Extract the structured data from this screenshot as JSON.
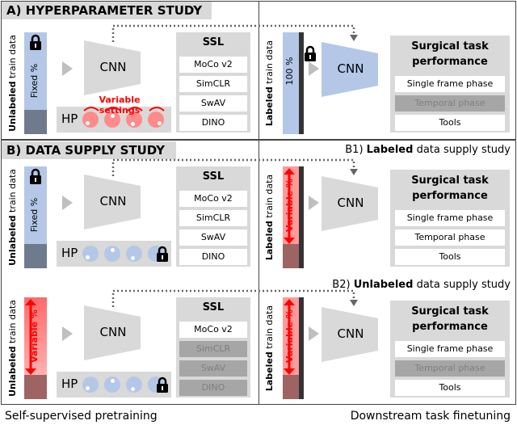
{
  "colors": {
    "blue": "#b4c7e7",
    "dark": "#6f7a8c",
    "red": "#ff3b3b",
    "pink": "#ff9a9a",
    "darkred": "#9e6464",
    "gray": "#d9d9d9"
  },
  "titles": {
    "a": "A) HYPERPARAMETER STUDY",
    "b": "B) DATA SUPPLY STUDY"
  },
  "sub": {
    "b1_prefix": "B1) ",
    "b1_bold": "Labeled",
    "b1_rest": " data supply study",
    "b2_prefix": "B2) ",
    "b2_bold": "Unlabeled",
    "b2_rest": " data supply study"
  },
  "footer": {
    "left": "Self-supervised pretraining",
    "right": "Downstream task finetuning"
  },
  "common": {
    "unlabeled_bold": "Unlabeled",
    "labeled_bold": "Labeled",
    "train_data": " train data",
    "cnn": "CNN",
    "hp": "HP",
    "ssl": "SSL",
    "surgical_1": "Surgical task",
    "surgical_2": "performance",
    "variable_settings": "Variable settings",
    "icons": [
      "lock-icon",
      "arrow-right-icon",
      "double-arrow-icon"
    ]
  },
  "panels": [
    {
      "left_bar": "Fixed %",
      "left_mode": "fixed",
      "hp_mode": "variable",
      "ssl": [
        {
          "label": "MoCo v2",
          "on": true
        },
        {
          "label": "SimCLR",
          "on": true
        },
        {
          "label": "SwAV",
          "on": true
        },
        {
          "label": "DINO",
          "on": true
        }
      ],
      "right_bar": "100 %",
      "right_mode": "full",
      "tasks": [
        {
          "label": "Single frame phase",
          "on": true
        },
        {
          "label": "Temporal phase",
          "on": false
        },
        {
          "label": "Tools",
          "on": true
        }
      ]
    },
    {
      "left_bar": "Fixed %",
      "left_mode": "fixed",
      "hp_mode": "locked",
      "ssl": [
        {
          "label": "MoCo v2",
          "on": true
        },
        {
          "label": "SimCLR",
          "on": true
        },
        {
          "label": "SwAV",
          "on": true
        },
        {
          "label": "DINO",
          "on": true
        }
      ],
      "right_bar": "Variable %",
      "right_mode": "variable",
      "tasks": [
        {
          "label": "Single frame phase",
          "on": true
        },
        {
          "label": "Temporal phase",
          "on": true
        },
        {
          "label": "Tools",
          "on": true
        }
      ]
    },
    {
      "left_bar": "Variable %",
      "left_mode": "variable",
      "hp_mode": "locked",
      "ssl": [
        {
          "label": "MoCo v2",
          "on": true
        },
        {
          "label": "SimCLR",
          "on": false
        },
        {
          "label": "SwAV",
          "on": false
        },
        {
          "label": "DINO",
          "on": false
        }
      ],
      "right_bar": "Variable %",
      "right_mode": "variable",
      "tasks": [
        {
          "label": "Single frame phase",
          "on": true
        },
        {
          "label": "Temporal phase",
          "on": false
        },
        {
          "label": "Tools",
          "on": true
        }
      ]
    }
  ]
}
